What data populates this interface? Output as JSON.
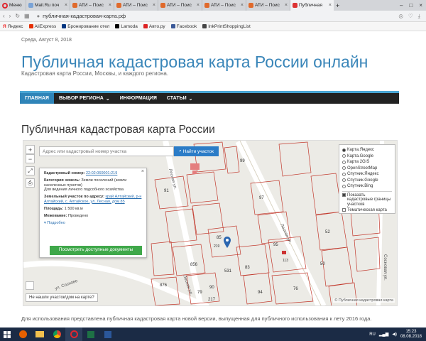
{
  "browser": {
    "menu_label": "Меню",
    "tabs": [
      {
        "label": "Mail.Ru поч"
      },
      {
        "label": "АТИ – Поис"
      },
      {
        "label": "АТИ – Поис"
      },
      {
        "label": "АТИ – Поис"
      },
      {
        "label": "АТИ – Поис"
      },
      {
        "label": "АТИ – Поис"
      },
      {
        "label": "Публичная"
      }
    ],
    "url": "публичная-кадастровая-карта.рф",
    "bookmarks": [
      "Яндекс",
      "AliExpress",
      "Бронирование отел",
      "Lamoda",
      "Авто.ру",
      "Facebook",
      "InkPrintShoppingList"
    ]
  },
  "page": {
    "date": "Среда, Август 8, 2018",
    "site_title": "Публичная кадастровая карта России онлайн",
    "tagline": "Кадастровая карта России, Москвы, и каждого региона.",
    "nav": [
      "ГЛАВНАЯ",
      "ВЫБОР РЕГИОНА",
      "ИНФОРМАЦИЯ",
      "СТАТЬИ"
    ],
    "heading": "Публичная кадастровая карта России",
    "body_text": "Для использования представлена публичная кадастровая карта новой версии, выпущенная для публичного использования к лету 2016 года."
  },
  "map": {
    "search_placeholder": "Адрес или кадастровый номер участка",
    "search_button": "Найти участок",
    "zoom_in": "+",
    "zoom_out": "−",
    "info": {
      "cadastral_label": "Кадастровый номер:",
      "cadastral_value": "22:02:060001:219",
      "category_label": "Категория земель:",
      "category_value": "Земли поселений (земли населенных пунктов)",
      "use_value": "Для ведения личного подсобного хозяйства",
      "address_label": "Земельный участок по адресу:",
      "address_value": "край Алтайский, р-н Алтайский, с. Алтайское, ул. Лесная, дом 85",
      "area_label": "Площадь:",
      "area_value": "1 500 кв.м",
      "survey_label": "Межевание:",
      "survey_value": "Проведено",
      "more_link": "Подробно",
      "docs_button": "Посмотреть доступные документы"
    },
    "layers": {
      "options": [
        {
          "label": "Карта.Яндекс",
          "selected": true
        },
        {
          "label": "Карта.Google",
          "selected": false
        },
        {
          "label": "Карта 2GIS",
          "selected": false
        },
        {
          "label": "OpenStreetMap",
          "selected": false
        },
        {
          "label": "Спутник.Яндекс",
          "selected": false
        },
        {
          "label": "Спутник.Google",
          "selected": false
        },
        {
          "label": "Спутник.Bing",
          "selected": false
        }
      ],
      "checkboxes": [
        {
          "label": "Показать кадастровые границы участков",
          "checked": true
        },
        {
          "label": "Тематическая карта",
          "checked": false
        }
      ]
    },
    "not_found": "Не нашли участок/дом на карте?",
    "attribution": "© Публичная кадастровая карта",
    "labels": {
      "street1": "Лесная ул.",
      "street2": "Лесная ул.",
      "street3": "ул. Сосново",
      "street4": "Сосновая ул.",
      "street5": "Лесная ул.",
      "lots": [
        "91",
        "85",
        "219",
        "95",
        "97",
        "52",
        "83",
        "50",
        "856",
        "876",
        "99",
        "90",
        "79",
        "76",
        "94",
        "113",
        "217",
        "531"
      ]
    }
  },
  "taskbar": {
    "lang": "RU",
    "time": "15:23",
    "date": "08.08.2018"
  },
  "colors": {
    "title_blue": "#3a86b9",
    "nav_active": "#2f84b8",
    "search_btn": "#2b7cc7",
    "docs_btn": "#3fa84a",
    "taskbar": "#1b2b45"
  }
}
